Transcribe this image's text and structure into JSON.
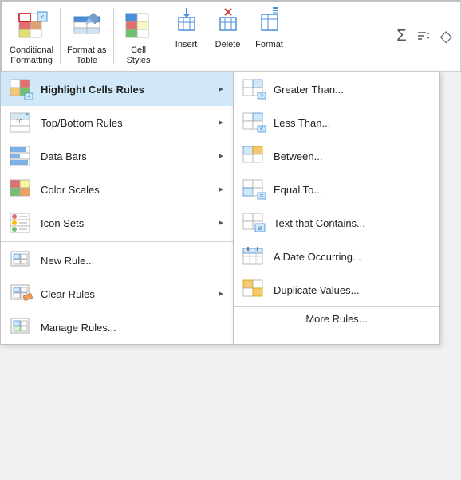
{
  "ribbon": {
    "buttons": [
      {
        "id": "conditional-formatting",
        "label": "Conditional\nFormatting",
        "dropdown": true
      },
      {
        "id": "format-as-table",
        "label": "Format as\nTable",
        "dropdown": true
      },
      {
        "id": "cell-styles",
        "label": "Cell\nStyles",
        "dropdown": true
      }
    ],
    "actions": [
      {
        "id": "insert",
        "label": "Insert",
        "dropdown": true
      },
      {
        "id": "delete",
        "label": "Delete",
        "dropdown": true
      },
      {
        "id": "format",
        "label": "Format",
        "dropdown": true
      }
    ]
  },
  "left_menu": {
    "items": [
      {
        "id": "highlight-cells",
        "label": "Highlight Cells Rules",
        "has_submenu": true,
        "highlighted": true
      },
      {
        "id": "top-bottom",
        "label": "Top/Bottom Rules",
        "has_submenu": true
      },
      {
        "id": "data-bars",
        "label": "Data Bars",
        "has_submenu": true
      },
      {
        "id": "color-scales",
        "label": "Color Scales",
        "has_submenu": true
      },
      {
        "id": "icon-sets",
        "label": "Icon Sets",
        "has_submenu": true
      },
      {
        "id": "new-rule",
        "label": "New Rule...",
        "has_submenu": false
      },
      {
        "id": "clear-rules",
        "label": "Clear Rules",
        "has_submenu": true
      },
      {
        "id": "manage-rules",
        "label": "Manage Rules...",
        "has_submenu": false
      }
    ]
  },
  "right_menu": {
    "items": [
      {
        "id": "greater-than",
        "label": "Greater Than..."
      },
      {
        "id": "less-than",
        "label": "Less Than..."
      },
      {
        "id": "between",
        "label": "Between..."
      },
      {
        "id": "equal-to",
        "label": "Equal To..."
      },
      {
        "id": "text-contains",
        "label": "Text that Contains..."
      },
      {
        "id": "date-occurring",
        "label": "A Date Occurring..."
      },
      {
        "id": "duplicate-values",
        "label": "Duplicate Values..."
      }
    ],
    "more": "More Rules..."
  }
}
